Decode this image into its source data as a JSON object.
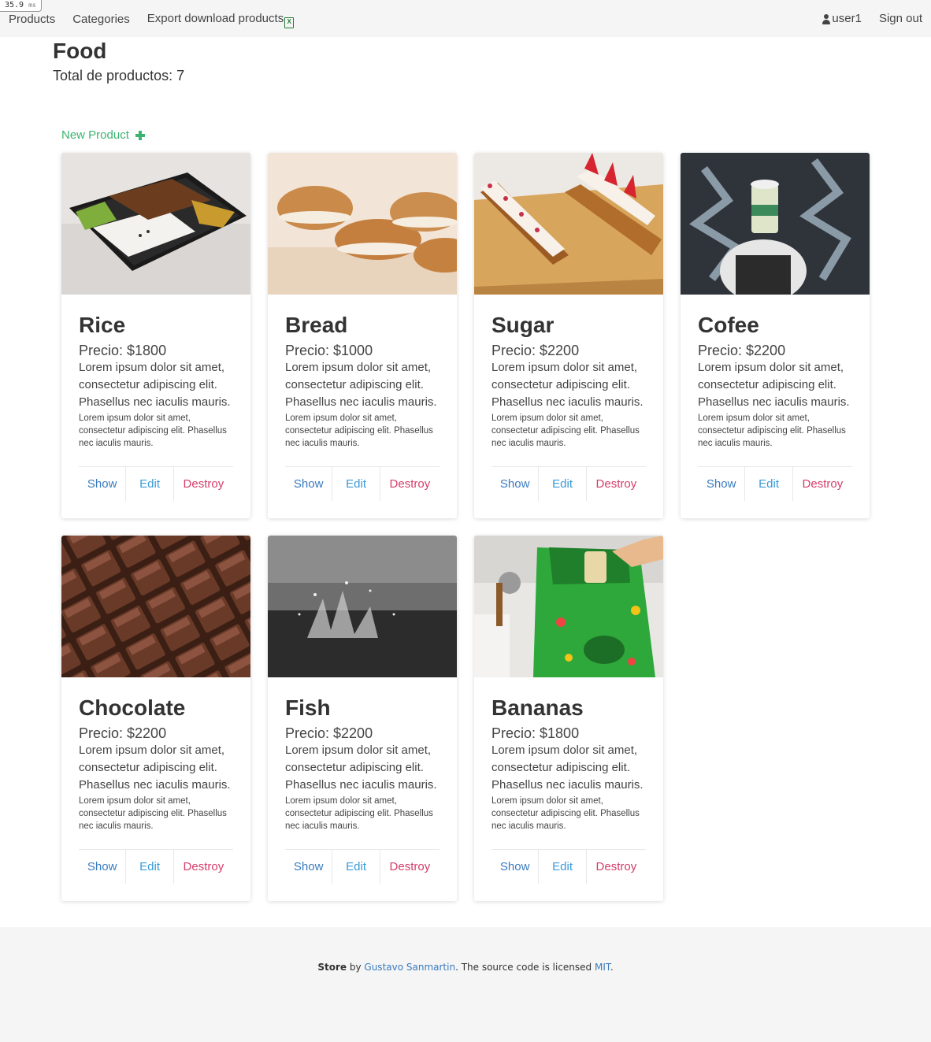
{
  "timing": {
    "value": "35.9",
    "unit": "ms"
  },
  "nav": {
    "products": "Products",
    "categories": "Categories",
    "export": "Export download products",
    "user": "user1",
    "sign_out": "Sign out"
  },
  "page": {
    "title": "Food",
    "total": "Total de productos: 7",
    "new_product": "New Product"
  },
  "products": [
    {
      "name": "Rice",
      "price": "Precio: $1800",
      "desc": "Lorem ipsum dolor sit amet, consectetur adipiscing elit. Phasellus nec iaculis mauris.",
      "small": "Lorem ipsum dolor sit amet, consectetur adipiscing elit. Phasellus nec iaculis mauris.",
      "show": "Show",
      "edit": "Edit",
      "destroy": "Destroy"
    },
    {
      "name": "Bread",
      "price": "Precio: $1000",
      "desc": "Lorem ipsum dolor sit amet, consectetur adipiscing elit. Phasellus nec iaculis mauris.",
      "small": "Lorem ipsum dolor sit amet, consectetur adipiscing elit. Phasellus nec iaculis mauris.",
      "show": "Show",
      "edit": "Edit",
      "destroy": "Destroy"
    },
    {
      "name": "Sugar",
      "price": "Precio: $2200",
      "desc": "Lorem ipsum dolor sit amet, consectetur adipiscing elit. Phasellus nec iaculis mauris.",
      "small": "Lorem ipsum dolor sit amet, consectetur adipiscing elit. Phasellus nec iaculis mauris.",
      "show": "Show",
      "edit": "Edit",
      "destroy": "Destroy"
    },
    {
      "name": "Cofee",
      "price": "Precio: $2200",
      "desc": "Lorem ipsum dolor sit amet, consectetur adipiscing elit. Phasellus nec iaculis mauris.",
      "small": "Lorem ipsum dolor sit amet, consectetur adipiscing elit. Phasellus nec iaculis mauris.",
      "show": "Show",
      "edit": "Edit",
      "destroy": "Destroy"
    },
    {
      "name": "Chocolate",
      "price": "Precio: $2200",
      "desc": "Lorem ipsum dolor sit amet, consectetur adipiscing elit. Phasellus nec iaculis mauris.",
      "small": "Lorem ipsum dolor sit amet, consectetur adipiscing elit. Phasellus nec iaculis mauris.",
      "show": "Show",
      "edit": "Edit",
      "destroy": "Destroy"
    },
    {
      "name": "Fish",
      "price": "Precio: $2200",
      "desc": "Lorem ipsum dolor sit amet, consectetur adipiscing elit. Phasellus nec iaculis mauris.",
      "small": "Lorem ipsum dolor sit amet, consectetur adipiscing elit. Phasellus nec iaculis mauris.",
      "show": "Show",
      "edit": "Edit",
      "destroy": "Destroy"
    },
    {
      "name": "Bananas",
      "price": "Precio: $1800",
      "desc": "Lorem ipsum dolor sit amet, consectetur adipiscing elit. Phasellus nec iaculis mauris.",
      "small": "Lorem ipsum dolor sit amet, consectetur adipiscing elit. Phasellus nec iaculis mauris.",
      "show": "Show",
      "edit": "Edit",
      "destroy": "Destroy"
    }
  ],
  "footer": {
    "brand": "Store",
    "by": "by",
    "author": "Gustavo Sanmartin",
    "mid": ". The source code is licensed",
    "license": "MIT",
    "end": "."
  }
}
